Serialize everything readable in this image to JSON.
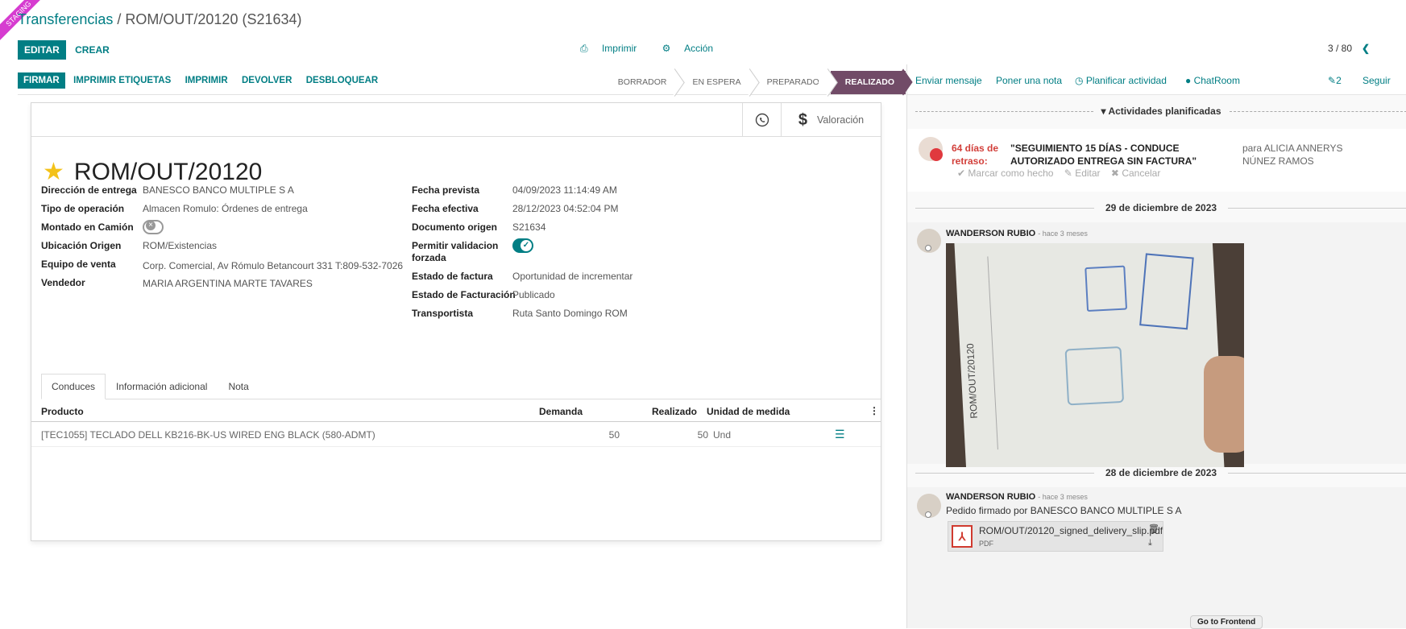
{
  "ribbon": "STAGING",
  "breadcrumb": {
    "parent": "Transferencias",
    "sep": " / ",
    "current": "ROM/OUT/20120 (S21634)"
  },
  "control": {
    "edit": "EDITAR",
    "create": "CREAR",
    "print": "Imprimir",
    "action": "Acción",
    "pager": "3 / 80"
  },
  "status_buttons": [
    "FIRMAR",
    "IMPRIMIR ETIQUETAS",
    "IMPRIMIR",
    "DEVOLVER",
    "DESBLOQUEAR"
  ],
  "stages": [
    "BORRADOR",
    "EN ESPERA",
    "PREPARADO",
    "REALIZADO"
  ],
  "current_stage": "REALIZADO",
  "smart_buttons": {
    "valuation": "Valoración"
  },
  "record": {
    "name": "ROM/OUT/20120",
    "left": [
      {
        "label": "Dirección de entrega",
        "value": "BANESCO BANCO MULTIPLE S A"
      },
      {
        "label": "Tipo de operación",
        "value": "Almacen Romulo: Órdenes de entrega"
      },
      {
        "label": "Montado en Camión",
        "value": ""
      },
      {
        "label": "Ubicación Origen",
        "value": "ROM/Existencias"
      },
      {
        "label": "Equipo de venta",
        "value": "Corp. Comercial, Av Rómulo Betancourt 331 T:809-532-7026"
      },
      {
        "label": "Vendedor",
        "value": "MARIA ARGENTINA MARTE TAVARES"
      }
    ],
    "right": [
      {
        "label": "Fecha prevista",
        "value": "04/09/2023 11:14:49 AM"
      },
      {
        "label": "Fecha efectiva",
        "value": "28/12/2023 04:52:04 PM"
      },
      {
        "label": "Documento origen",
        "value": "S21634"
      },
      {
        "label": "Permitir validacion forzada",
        "value": ""
      },
      {
        "label": "Estado de factura",
        "value": "Oportunidad de incrementar"
      },
      {
        "label": "Estado de Facturación",
        "value": "Publicado"
      },
      {
        "label": "Transportista",
        "value": "Ruta Santo Domingo ROM"
      }
    ],
    "montado_en_camion": false,
    "permitir_validacion_forzada": true
  },
  "tabs": [
    "Conduces",
    "Información adicional",
    "Nota"
  ],
  "table": {
    "headers": {
      "product": "Producto",
      "demand": "Demanda",
      "done": "Realizado",
      "uom": "Unidad de medida"
    },
    "rows": [
      {
        "product": "[TEC1055] TECLADO DELL KB216-BK-US WIRED ENG BLACK (580-ADMT)",
        "demand": "50",
        "done": "50",
        "uom": "Und"
      }
    ]
  },
  "chatter": {
    "send_message": "Enviar mensaje",
    "log_note": "Poner una nota",
    "schedule": "Planificar actividad",
    "chatroom": "ChatRoom",
    "attachments_count": "2",
    "follow": "Seguir",
    "planned_header": "Actividades planificadas",
    "activity": {
      "delay": "64 días de retraso:",
      "summary": "\"SEGUIMIENTO 15 DÍAS - CONDUCE AUTORIZADO ENTREGA SIN FACTURA\"",
      "assigned": "para ALICIA ANNERYS NÚNEZ RAMOS",
      "mark_done": "Marcar como hecho",
      "edit": "Editar",
      "cancel": "Cancelar"
    },
    "date1": "29 de diciembre de 2023",
    "msg1": {
      "author": "WANDERSON RUBIO",
      "time": "- hace 3 meses"
    },
    "date2": "28 de diciembre de 2023",
    "msg2": {
      "author": "WANDERSON RUBIO",
      "time": "- hace 3 meses",
      "body": "Pedido firmado por BANESCO BANCO MULTIPLE S A"
    },
    "attachment": {
      "name": "ROM/OUT/20120_signed_delivery_slip.pdf",
      "type": "PDF"
    },
    "photo_text": {
      "doc_number": "ROM/OUT/20120"
    }
  },
  "frontend_button": "Go to Frontend"
}
